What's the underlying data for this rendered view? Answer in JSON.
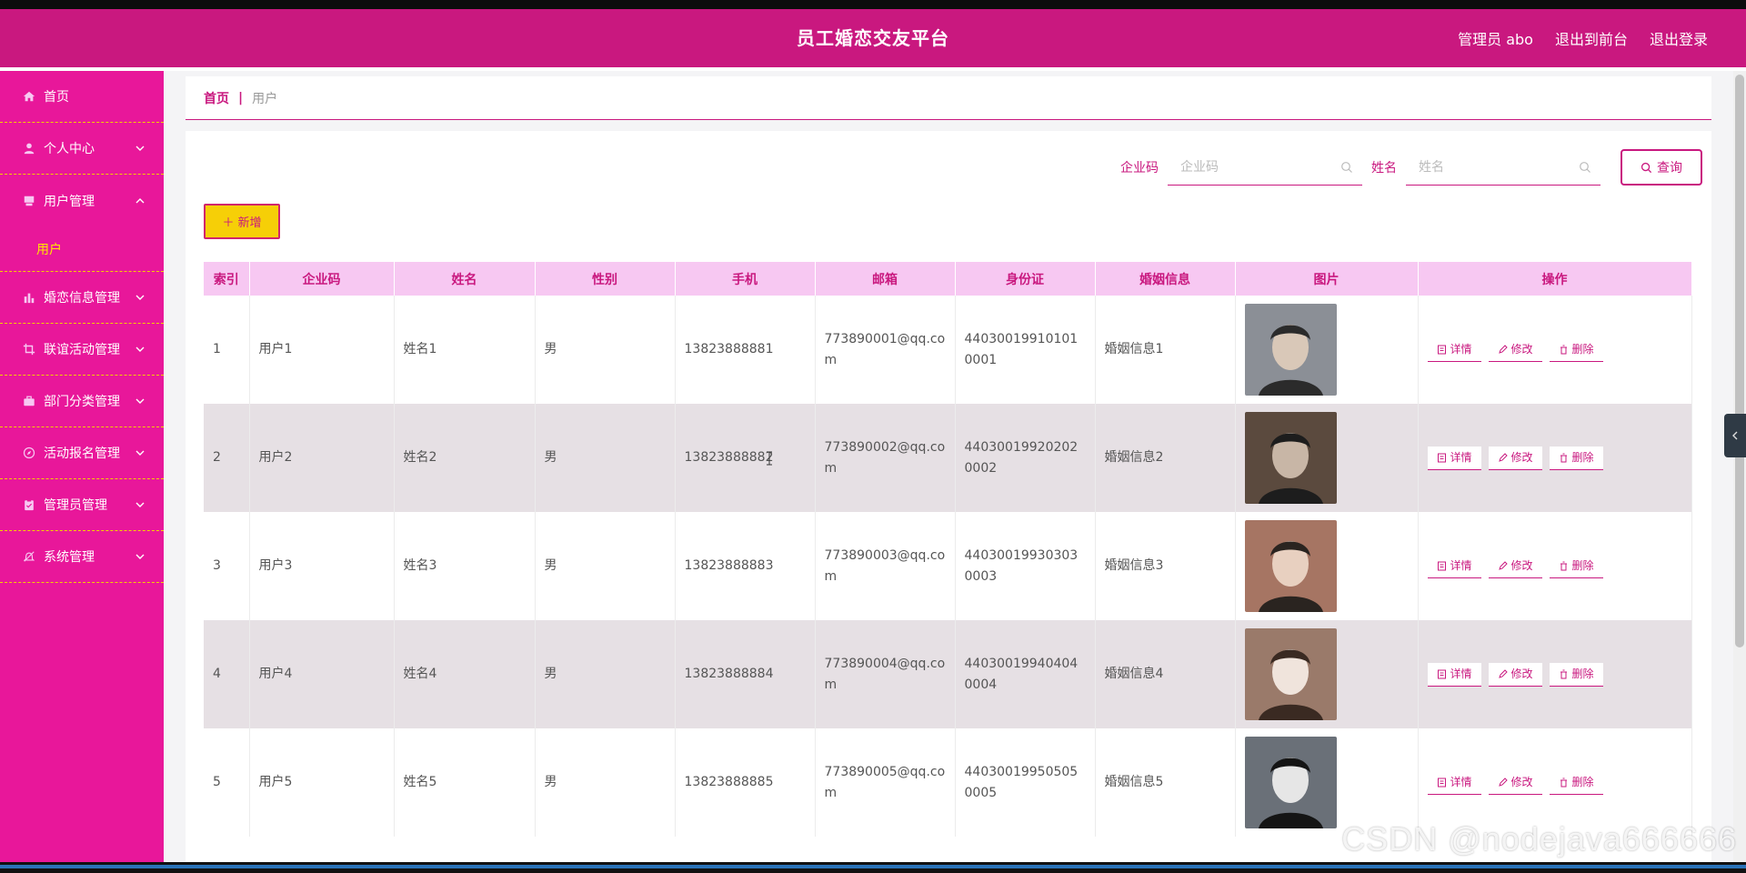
{
  "header": {
    "title": "员工婚恋交友平台",
    "links": [
      "管理员 abo",
      "退出到前台",
      "退出登录"
    ]
  },
  "sidebar": {
    "items": [
      {
        "label": "首页",
        "icon": "home-icon",
        "expandable": false
      },
      {
        "label": "个人中心",
        "icon": "user-icon",
        "expandable": true
      },
      {
        "label": "用户管理",
        "icon": "users-icon",
        "expandable": true,
        "expanded": true,
        "children": [
          "用户"
        ]
      },
      {
        "label": "婚恋信息管理",
        "icon": "chart-icon",
        "expandable": true
      },
      {
        "label": "联谊活动管理",
        "icon": "crop-icon",
        "expandable": true
      },
      {
        "label": "部门分类管理",
        "icon": "briefcase-icon",
        "expandable": true
      },
      {
        "label": "活动报名管理",
        "icon": "compass-icon",
        "expandable": true
      },
      {
        "label": "管理员管理",
        "icon": "clipboard-icon",
        "expandable": true
      },
      {
        "label": "系统管理",
        "icon": "bell-off-icon",
        "expandable": true
      }
    ]
  },
  "breadcrumb": {
    "home": "首页",
    "separator": "|",
    "current": "用户"
  },
  "search": {
    "company_label": "企业码",
    "company_placeholder": "企业码",
    "name_label": "姓名",
    "name_placeholder": "姓名",
    "query_label": "查询"
  },
  "add_button": "新增",
  "table": {
    "headers": [
      "索引",
      "企业码",
      "姓名",
      "性别",
      "手机",
      "邮箱",
      "身份证",
      "婚姻信息",
      "图片",
      "操作"
    ],
    "rows": [
      {
        "index": "1",
        "code": "用户1",
        "name": "姓名1",
        "gender": "男",
        "phone": "13823888881",
        "email": "773890001@qq.com",
        "idcard": "440300199101010001",
        "marriage": "婚姻信息1"
      },
      {
        "index": "2",
        "code": "用户2",
        "name": "姓名2",
        "gender": "男",
        "phone": "13823888882",
        "email": "773890002@qq.com",
        "idcard": "440300199202020002",
        "marriage": "婚姻信息2"
      },
      {
        "index": "3",
        "code": "用户3",
        "name": "姓名3",
        "gender": "男",
        "phone": "13823888883",
        "email": "773890003@qq.com",
        "idcard": "440300199303030003",
        "marriage": "婚姻信息3"
      },
      {
        "index": "4",
        "code": "用户4",
        "name": "姓名4",
        "gender": "男",
        "phone": "13823888884",
        "email": "773890004@qq.com",
        "idcard": "440300199404040004",
        "marriage": "婚姻信息4"
      },
      {
        "index": "5",
        "code": "用户5",
        "name": "姓名5",
        "gender": "男",
        "phone": "13823888885",
        "email": "773890005@qq.com",
        "idcard": "440300199505050005",
        "marriage": "婚姻信息5"
      }
    ],
    "actions": [
      "详情",
      "修改",
      "删除"
    ]
  },
  "watermark": "CSDN @nodejava666666",
  "colors": {
    "brand": "#c9187f",
    "sidebar": "#e8179a",
    "accent": "#f6cf07",
    "header_row": "#f7c8f2"
  }
}
